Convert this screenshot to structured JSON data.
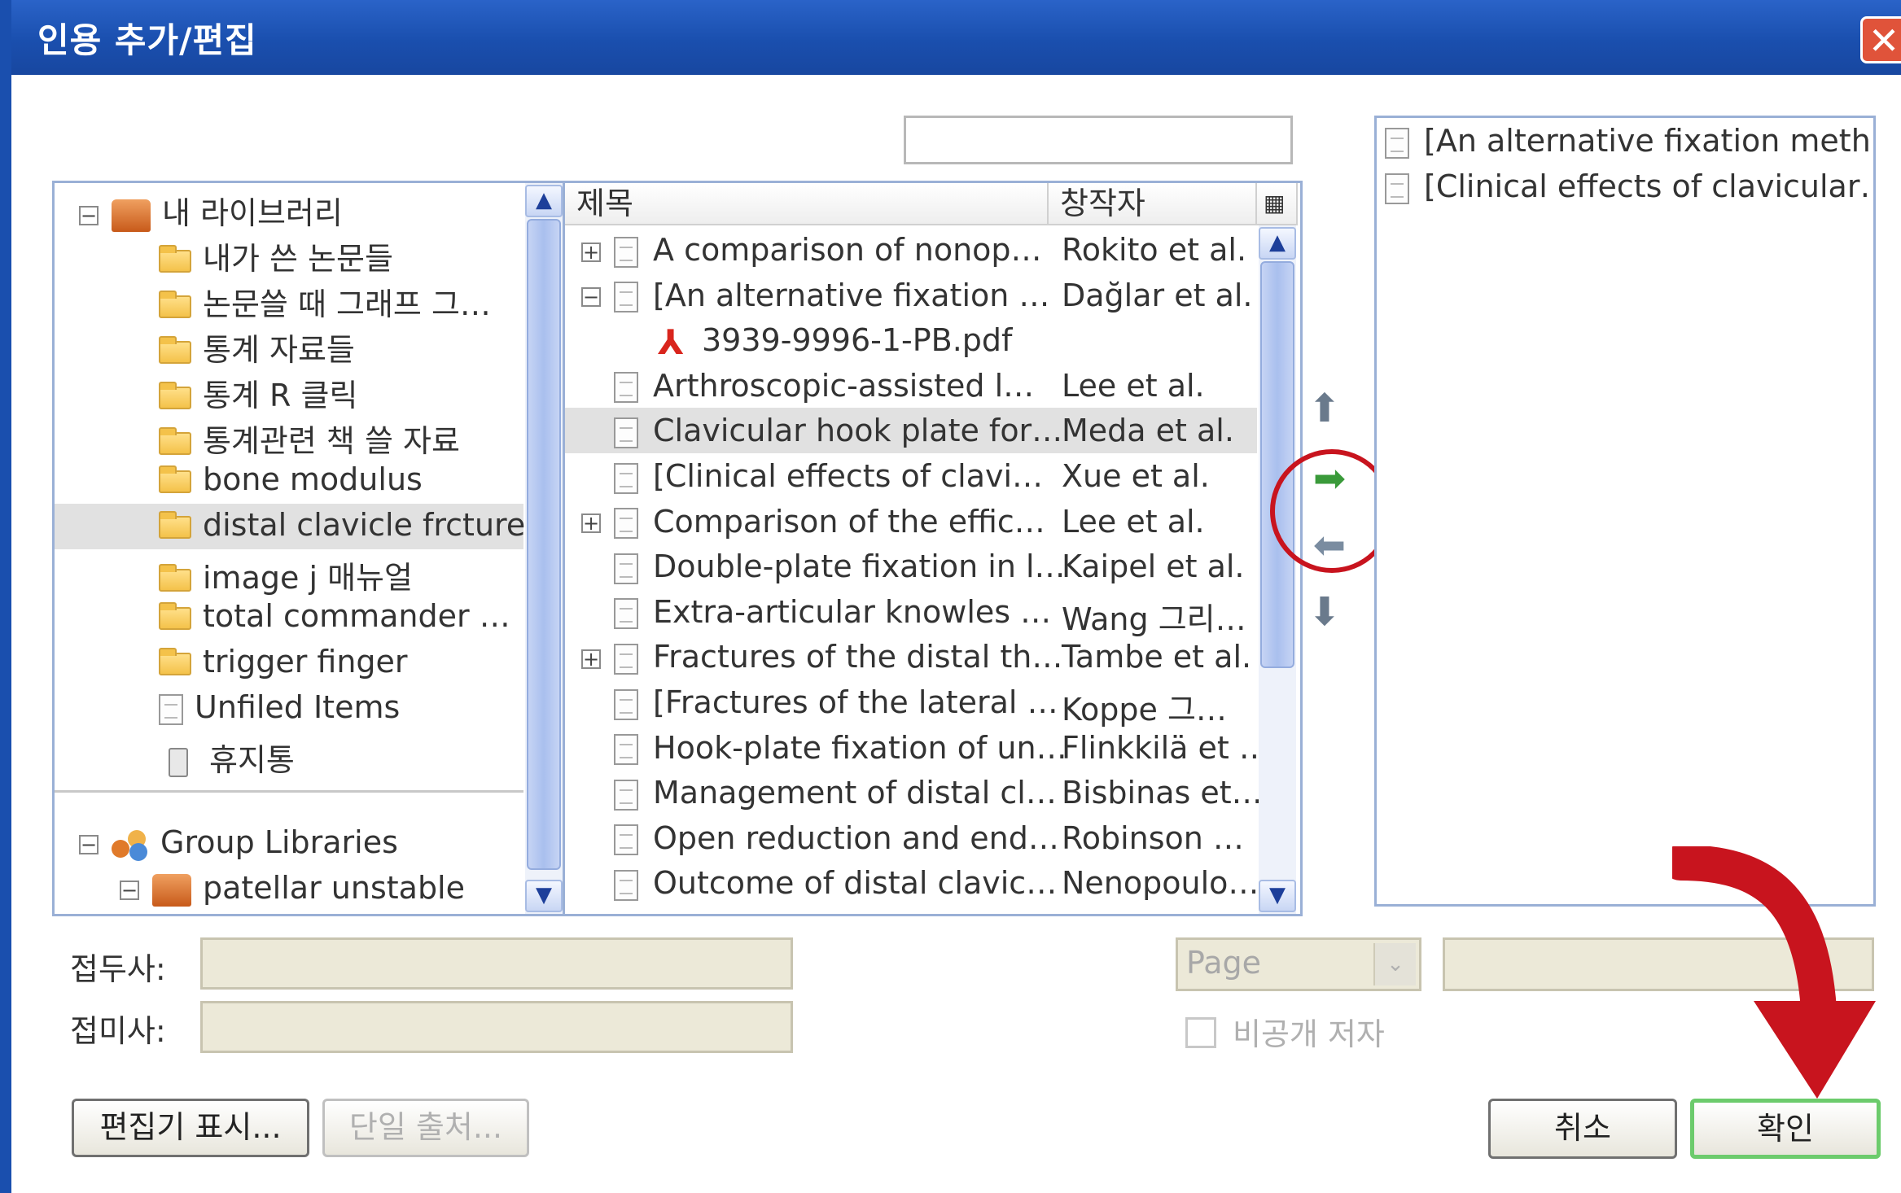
{
  "window": {
    "title": "인용 추가/편집",
    "close_glyph": "✕"
  },
  "library_tree": {
    "root": "내 라이브러리",
    "items": [
      "내가 쓴 논문들",
      "논문쓸 때 그래프 그…",
      "통계 자료들",
      "통계 R 클릭",
      "통계관련 책 쓸 자료",
      "bone modulus",
      "distal clavicle frcture",
      "image j 매뉴얼",
      "total commander …",
      "trigger finger",
      "Unfiled Items",
      "휴지통"
    ],
    "selected": "distal clavicle frcture",
    "group_root": "Group Libraries",
    "group_item": "patellar unstable"
  },
  "search": {
    "value": ""
  },
  "item_list": {
    "columns": {
      "title": "제목",
      "creator": "창작자"
    },
    "rows": [
      {
        "title": "A comparison of nonop…",
        "creator": "Rokito et al.",
        "expander": "+"
      },
      {
        "title": "[An alternative fixation …",
        "creator": "Dağlar et al.",
        "expander": "−"
      },
      {
        "title": "3939-9996-1-PB.pdf",
        "creator": "",
        "attachment": true
      },
      {
        "title": "Arthroscopic-assisted l…",
        "creator": "Lee et al."
      },
      {
        "title": "Clavicular hook plate for…",
        "creator": "Meda et al.",
        "selected": true
      },
      {
        "title": "[Clinical effects of clavi…",
        "creator": "Xue et al."
      },
      {
        "title": "Comparison of the effic…",
        "creator": "Lee et al.",
        "expander": "+"
      },
      {
        "title": "Double-plate fixation in l…",
        "creator": "Kaipel et al."
      },
      {
        "title": "Extra-articular knowles …",
        "creator": "Wang 그리…"
      },
      {
        "title": "Fractures of the distal th…",
        "creator": "Tambe et al.",
        "expander": "+"
      },
      {
        "title": "[Fractures of the lateral …",
        "creator": "Koppe 그…"
      },
      {
        "title": "Hook-plate fixation of un…",
        "creator": "Flinkkilä et …"
      },
      {
        "title": "Management of distal cl…",
        "creator": "Bisbinas et…"
      },
      {
        "title": "Open reduction and end…",
        "creator": "Robinson …"
      },
      {
        "title": "Outcome of distal clavic…",
        "creator": "Nenopoulo…"
      }
    ]
  },
  "citation_list": {
    "items": [
      "[An alternative fixation meth…",
      "[Clinical effects of clavicular…"
    ]
  },
  "move_buttons": {
    "up": "⬆",
    "add": "➡",
    "remove": "⬅",
    "down": "⬇"
  },
  "form": {
    "prefix_label": "접두사:",
    "suffix_label": "접미사:",
    "locator_select": "Page",
    "suppress_author_label": "비공개 저자"
  },
  "buttons": {
    "show_editor": "편집기 표시...",
    "single_source": "단일 출처...",
    "cancel": "취소",
    "ok": "확인"
  },
  "colors": {
    "title_bar": "#1a4fae",
    "selection": "#e1e1e1",
    "annotation_red": "#c8141e"
  }
}
